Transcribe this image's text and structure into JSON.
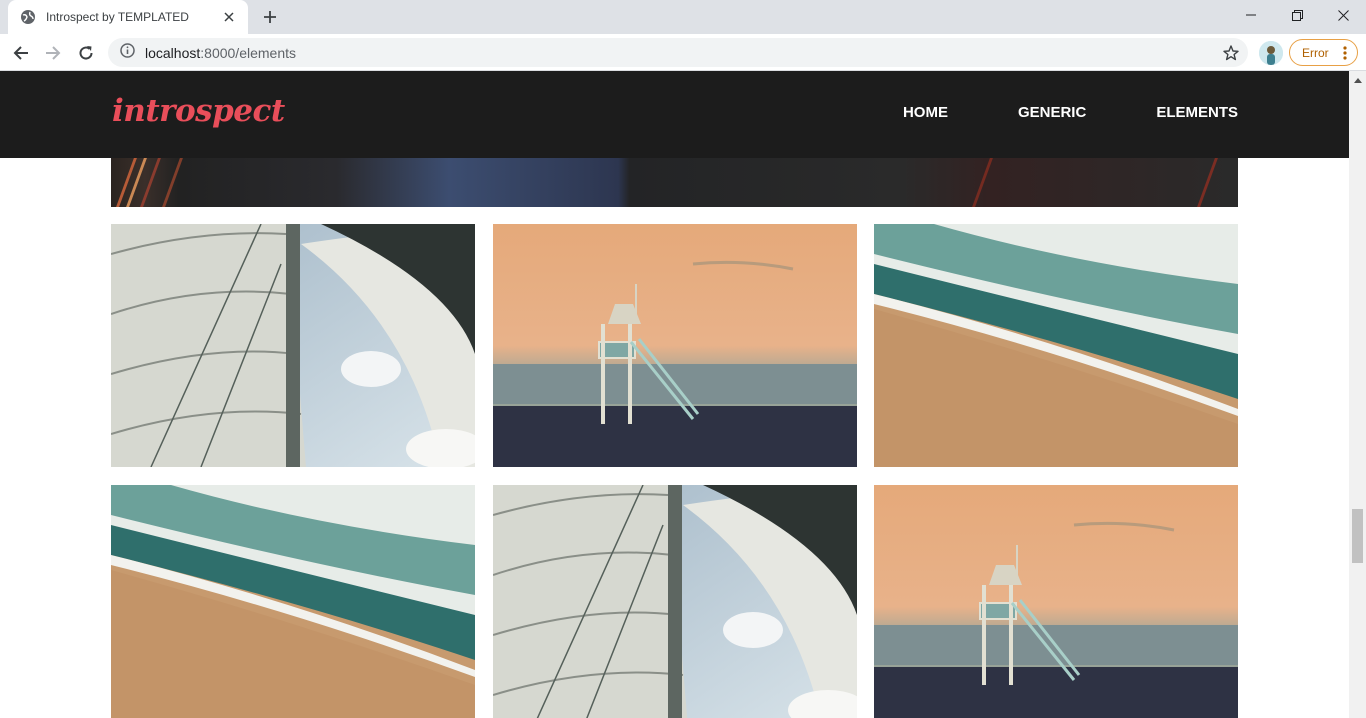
{
  "browser": {
    "tab_title": "Introspect by TEMPLATED",
    "url_host": "localhost",
    "url_path": ":8000/elements",
    "error_label": "Error"
  },
  "site": {
    "logo": "introspect",
    "nav": [
      "HOME",
      "GENERIC",
      "ELEMENTS"
    ],
    "colors": {
      "header_bg": "#1c1c1c",
      "logo": "#e94e5a"
    }
  },
  "gallery": {
    "images": [
      {
        "subject": "sail"
      },
      {
        "subject": "lifeguard-tower"
      },
      {
        "subject": "beach-waves"
      },
      {
        "subject": "beach-waves"
      },
      {
        "subject": "sail"
      },
      {
        "subject": "lifeguard-tower"
      }
    ]
  }
}
